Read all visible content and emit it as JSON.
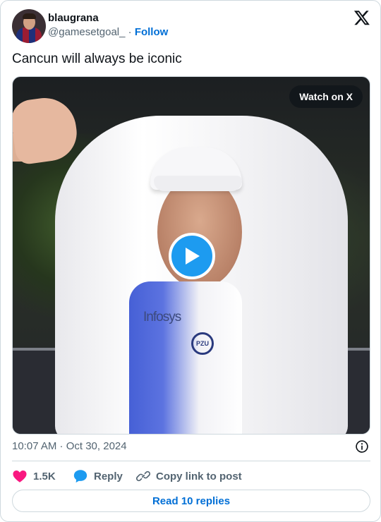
{
  "author": {
    "display_name": "blaugrana",
    "handle": "@gamesetgoal_",
    "separator": "·",
    "follow_label": "Follow"
  },
  "tweet": {
    "text": "Cancun will always be iconic",
    "timestamp": "10:07 AM · Oct 30, 2024"
  },
  "media": {
    "watch_label": "Watch on X",
    "shirt_text": "Infosys",
    "sponsor_text": "PZU"
  },
  "actions": {
    "like_count": "1.5K",
    "reply_label": "Reply",
    "copy_label": "Copy link to post"
  },
  "footer": {
    "read_replies_label": "Read 10 replies"
  },
  "colors": {
    "accent": "#006fd6",
    "play": "#1d9bf0",
    "like": "#f91880",
    "muted": "#536471"
  },
  "icons": [
    "x-logo-icon",
    "play-icon",
    "info-icon",
    "heart-icon",
    "reply-bubble-icon",
    "link-icon"
  ]
}
